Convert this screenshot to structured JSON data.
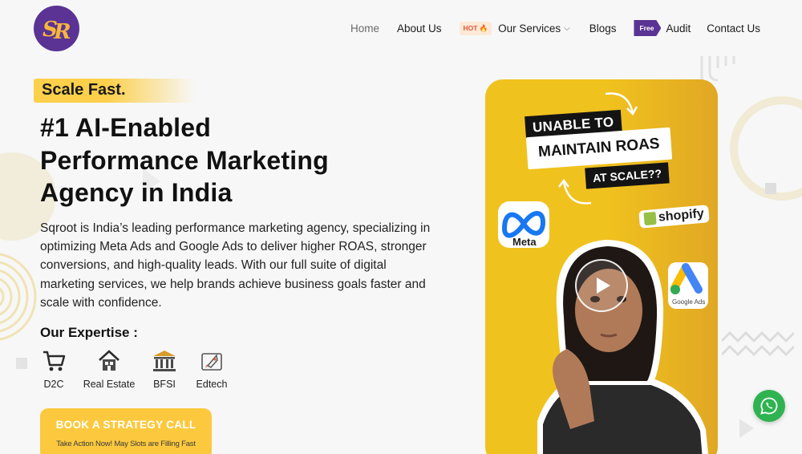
{
  "brand": {
    "logo_letters": "SR",
    "logo_color": "#5a3394",
    "accent_color": "#fcc93e"
  },
  "nav": {
    "home": "Home",
    "about": "About Us",
    "hot_badge": "HOT",
    "services": "Our Services",
    "blogs": "Blogs",
    "free_badge": "Free",
    "audit": "Audit",
    "contact": "Contact Us"
  },
  "hero": {
    "tag": "Scale Fast.",
    "headline_line1": "#1 AI-Enabled",
    "headline_line2": "Performance Marketing",
    "headline_line3": "Agency in India",
    "description": "Sqroot is India’s leading performance marketing agency, specializing in optimizing Meta Ads and Google Ads to deliver higher ROAS, stronger conversions, and high-quality leads. With our full suite of digital marketing services, we help brands achieve business goals faster and scale with confidence.",
    "expertise_title": "Our Expertise :",
    "expertise": [
      {
        "label": "D2C",
        "icon": "cart-icon"
      },
      {
        "label": "Real Estate",
        "icon": "house-icon"
      },
      {
        "label": "BFSI",
        "icon": "bank-icon"
      },
      {
        "label": "Edtech",
        "icon": "rocket-icon"
      }
    ],
    "cta_label": "BOOK A STRATEGY CALL",
    "cta_sub": "Take Action Now! May Slots are Filling Fast"
  },
  "video": {
    "caption1": "UNABLE TO",
    "caption2": "MAINTAIN ROAS",
    "caption3": "AT SCALE??",
    "meta_label": "Meta",
    "shopify_label": "shopify",
    "google_ads_label": "Google Ads"
  },
  "whatsapp_color": "#2fb350"
}
